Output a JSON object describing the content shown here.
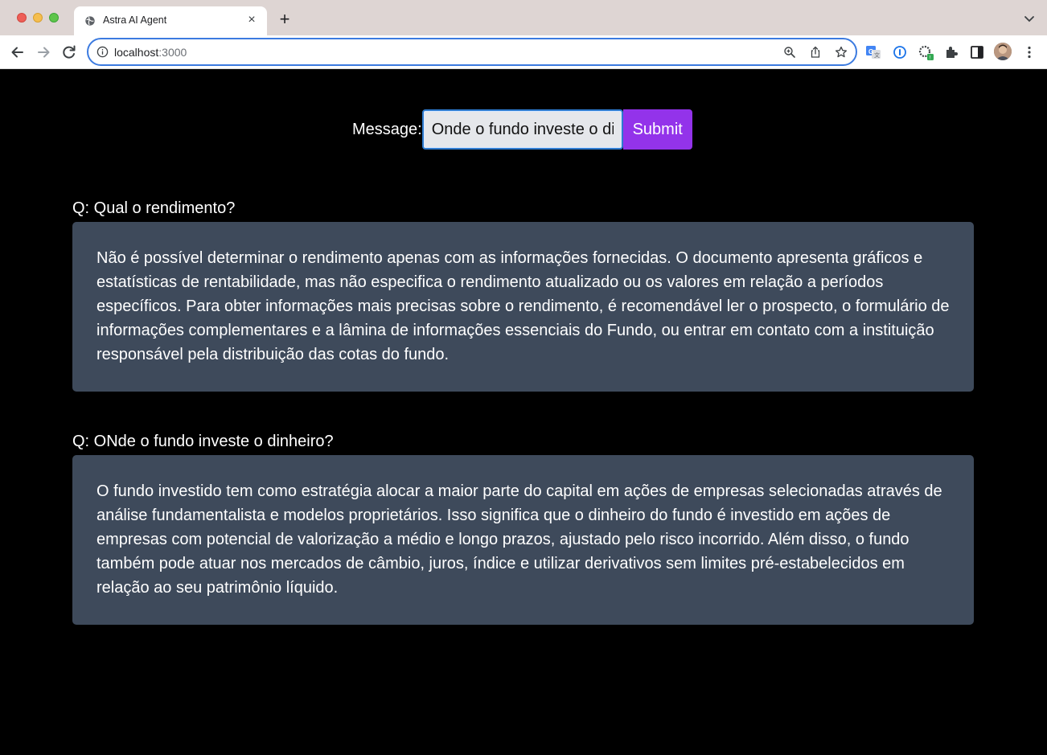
{
  "browser": {
    "tab": {
      "title": "Astra AI Agent"
    },
    "address": {
      "host": "localhost",
      "port": ":3000"
    }
  },
  "form": {
    "label": "Message:",
    "input_value": "Onde o fundo investe o dinheiro?",
    "submit_label": "Submit"
  },
  "conversation": [
    {
      "question": "Q: Qual o rendimento?",
      "answer": "Não é possível determinar o rendimento apenas com as informações fornecidas. O documento apresenta gráficos e estatísticas de rentabilidade, mas não especifica o rendimento atualizado ou os valores em relação a períodos específicos. Para obter informações mais precisas sobre o rendimento, é recomendável ler o prospecto, o formulário de informações complementares e a lâmina de informações essenciais do Fundo, ou entrar em contato com a instituição responsável pela distribuição das cotas do fundo."
    },
    {
      "question": "Q: ONde o fundo investe o dinheiro?",
      "answer": "O fundo investido tem como estratégia alocar a maior parte do capital em ações de empresas selecionadas através de análise fundamentalista e modelos proprietários. Isso significa que o dinheiro do fundo é investido em ações de empresas com potencial de valorização a médio e longo prazos, ajustado pelo risco incorrido. Além disso, o fundo também pode atuar nos mercados de câmbio, juros, índice e utilizar derivativos sem limites pré-estabelecidos em relação ao seu patrimônio líquido."
    }
  ],
  "colors": {
    "page_background": "#000000",
    "answer_background": "#3e4a5b",
    "submit_background": "#9333ea",
    "input_background": "#e5e7eb",
    "input_focus_border": "#2e7bcf"
  }
}
